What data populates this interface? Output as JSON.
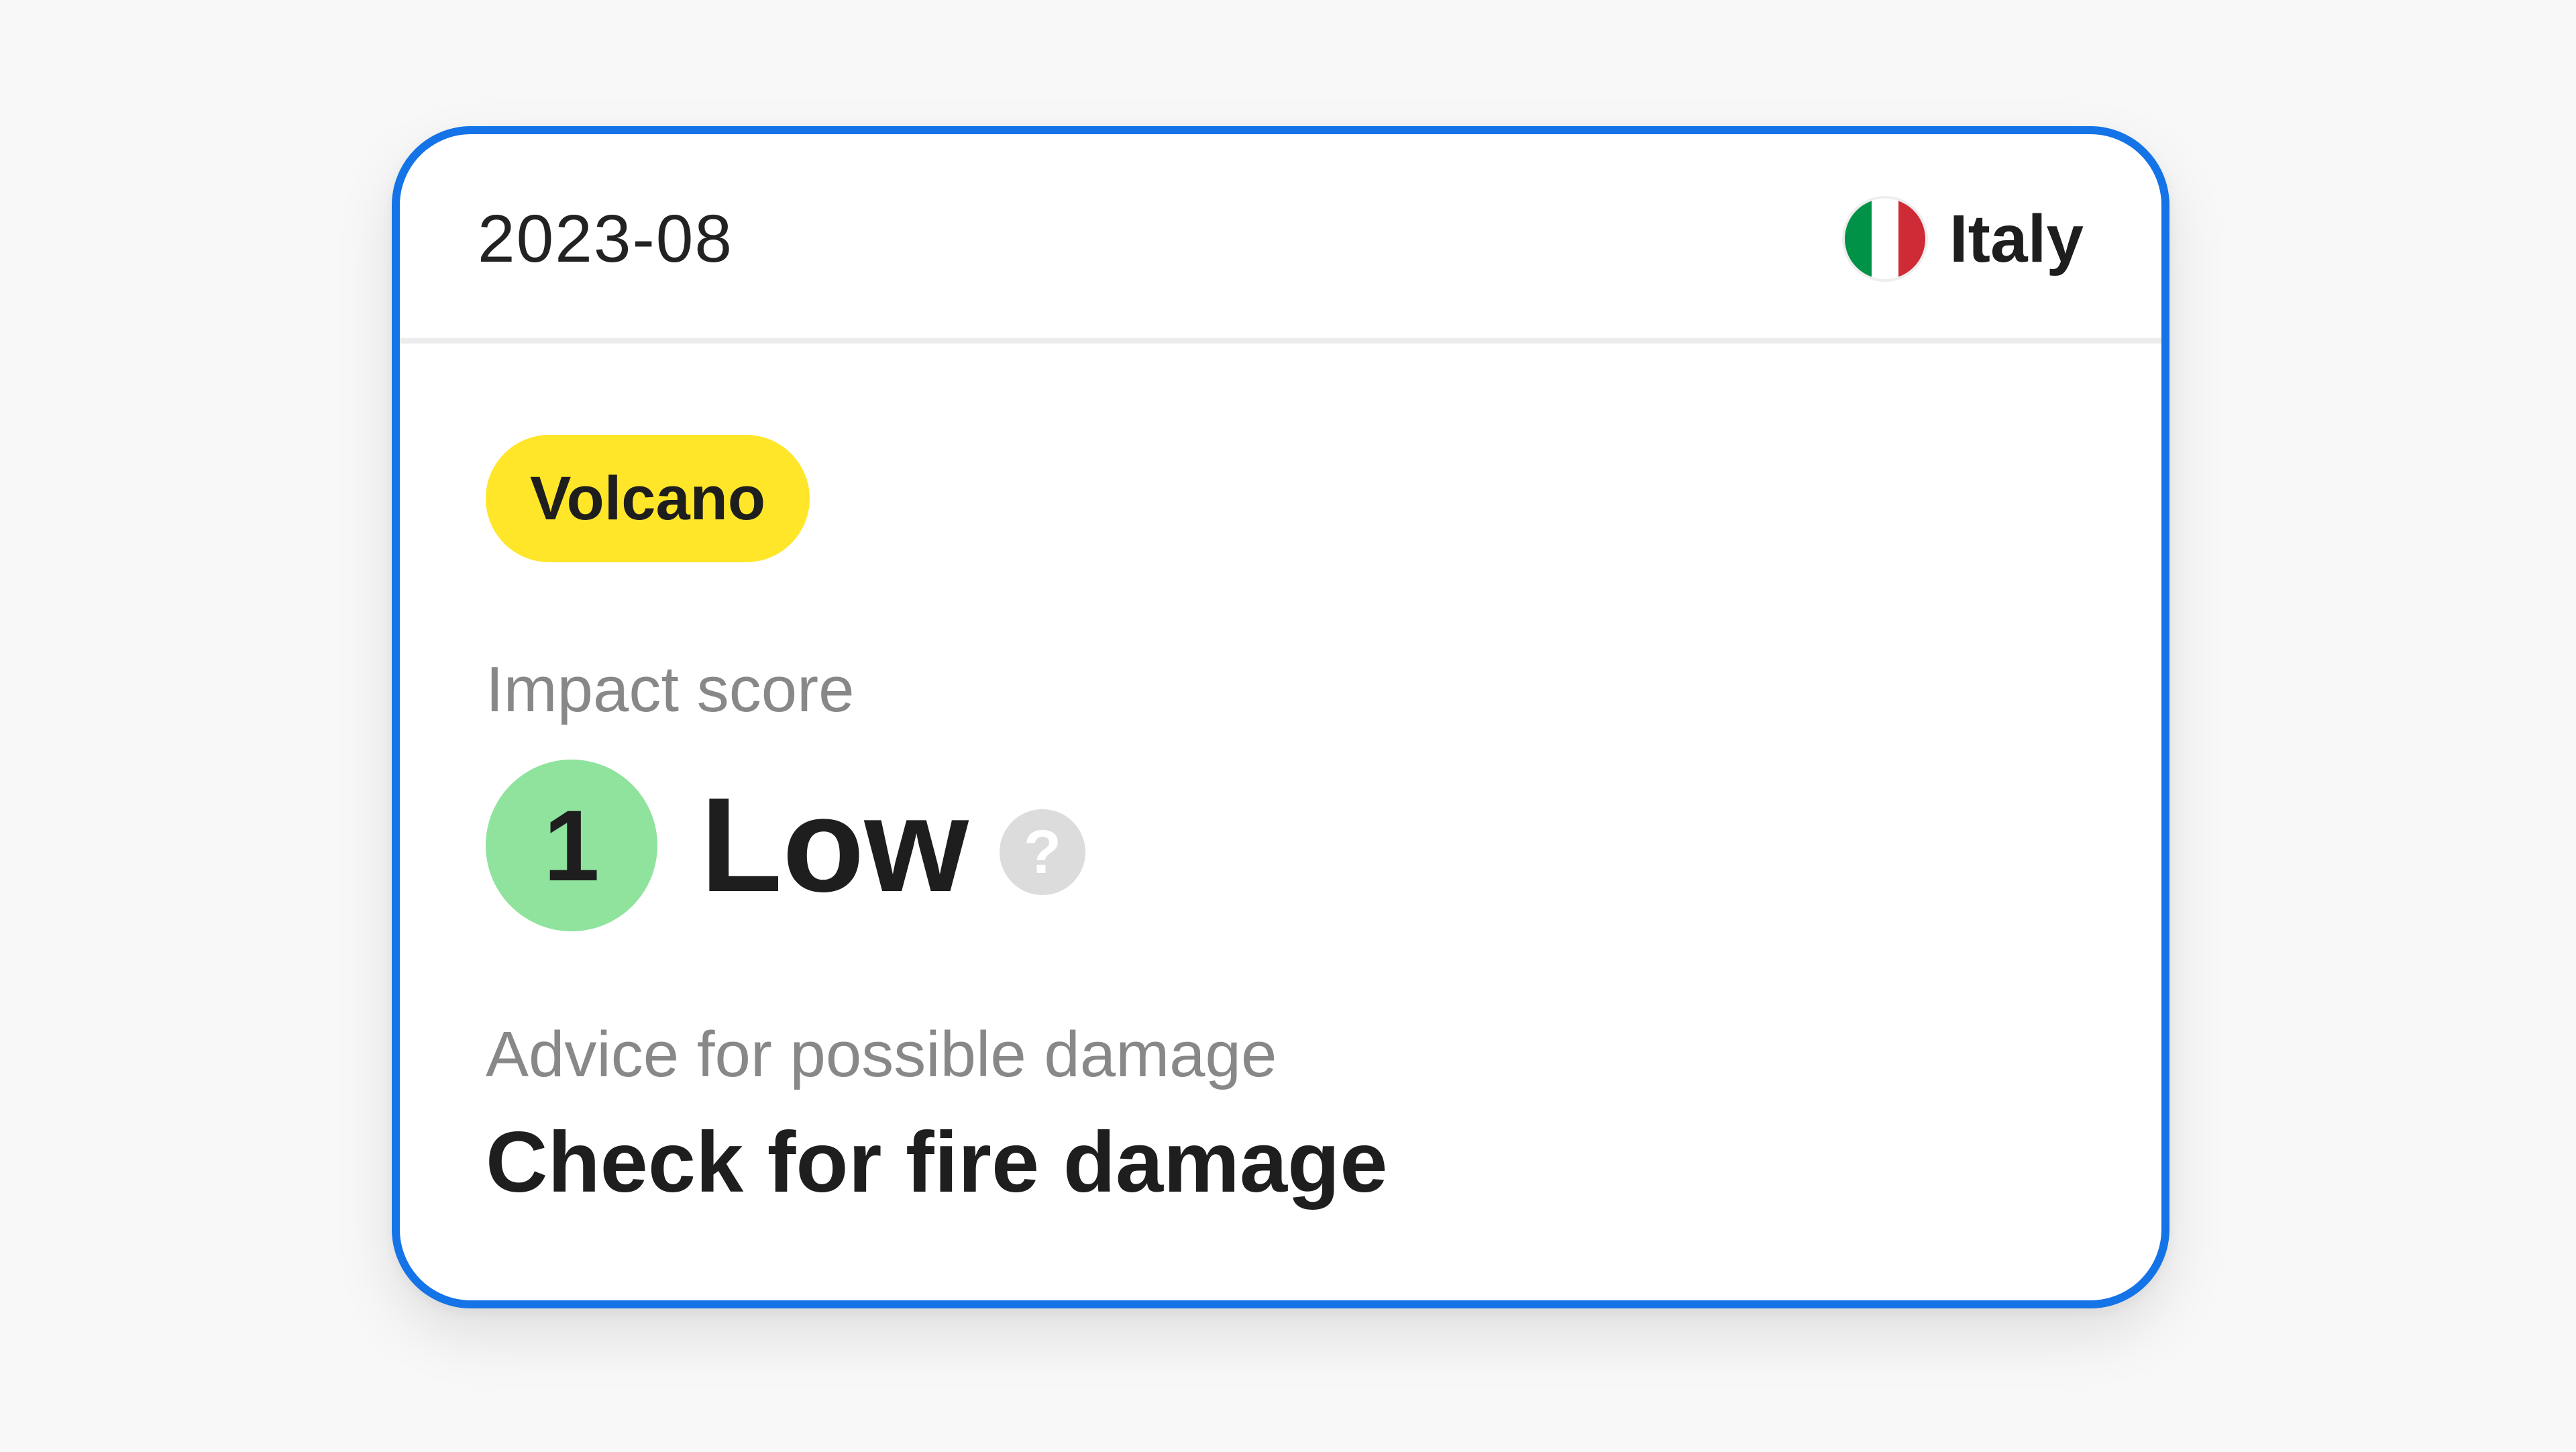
{
  "card": {
    "date": "2023-08",
    "country": {
      "name": "Italy",
      "flag_icon": "italy-flag-icon",
      "flag_colors": [
        "#009246",
        "#ffffff",
        "#ce2b37"
      ]
    },
    "event_badge": {
      "label": "Volcano",
      "color": "#ffe629"
    },
    "impact": {
      "label": "Impact score",
      "score": "1",
      "level": "Low",
      "score_color": "#8fe39d",
      "help_glyph": "?"
    },
    "advice": {
      "label": "Advice for possible damage",
      "text": "Check for fire damage"
    },
    "accent_color": "#1473e6"
  }
}
